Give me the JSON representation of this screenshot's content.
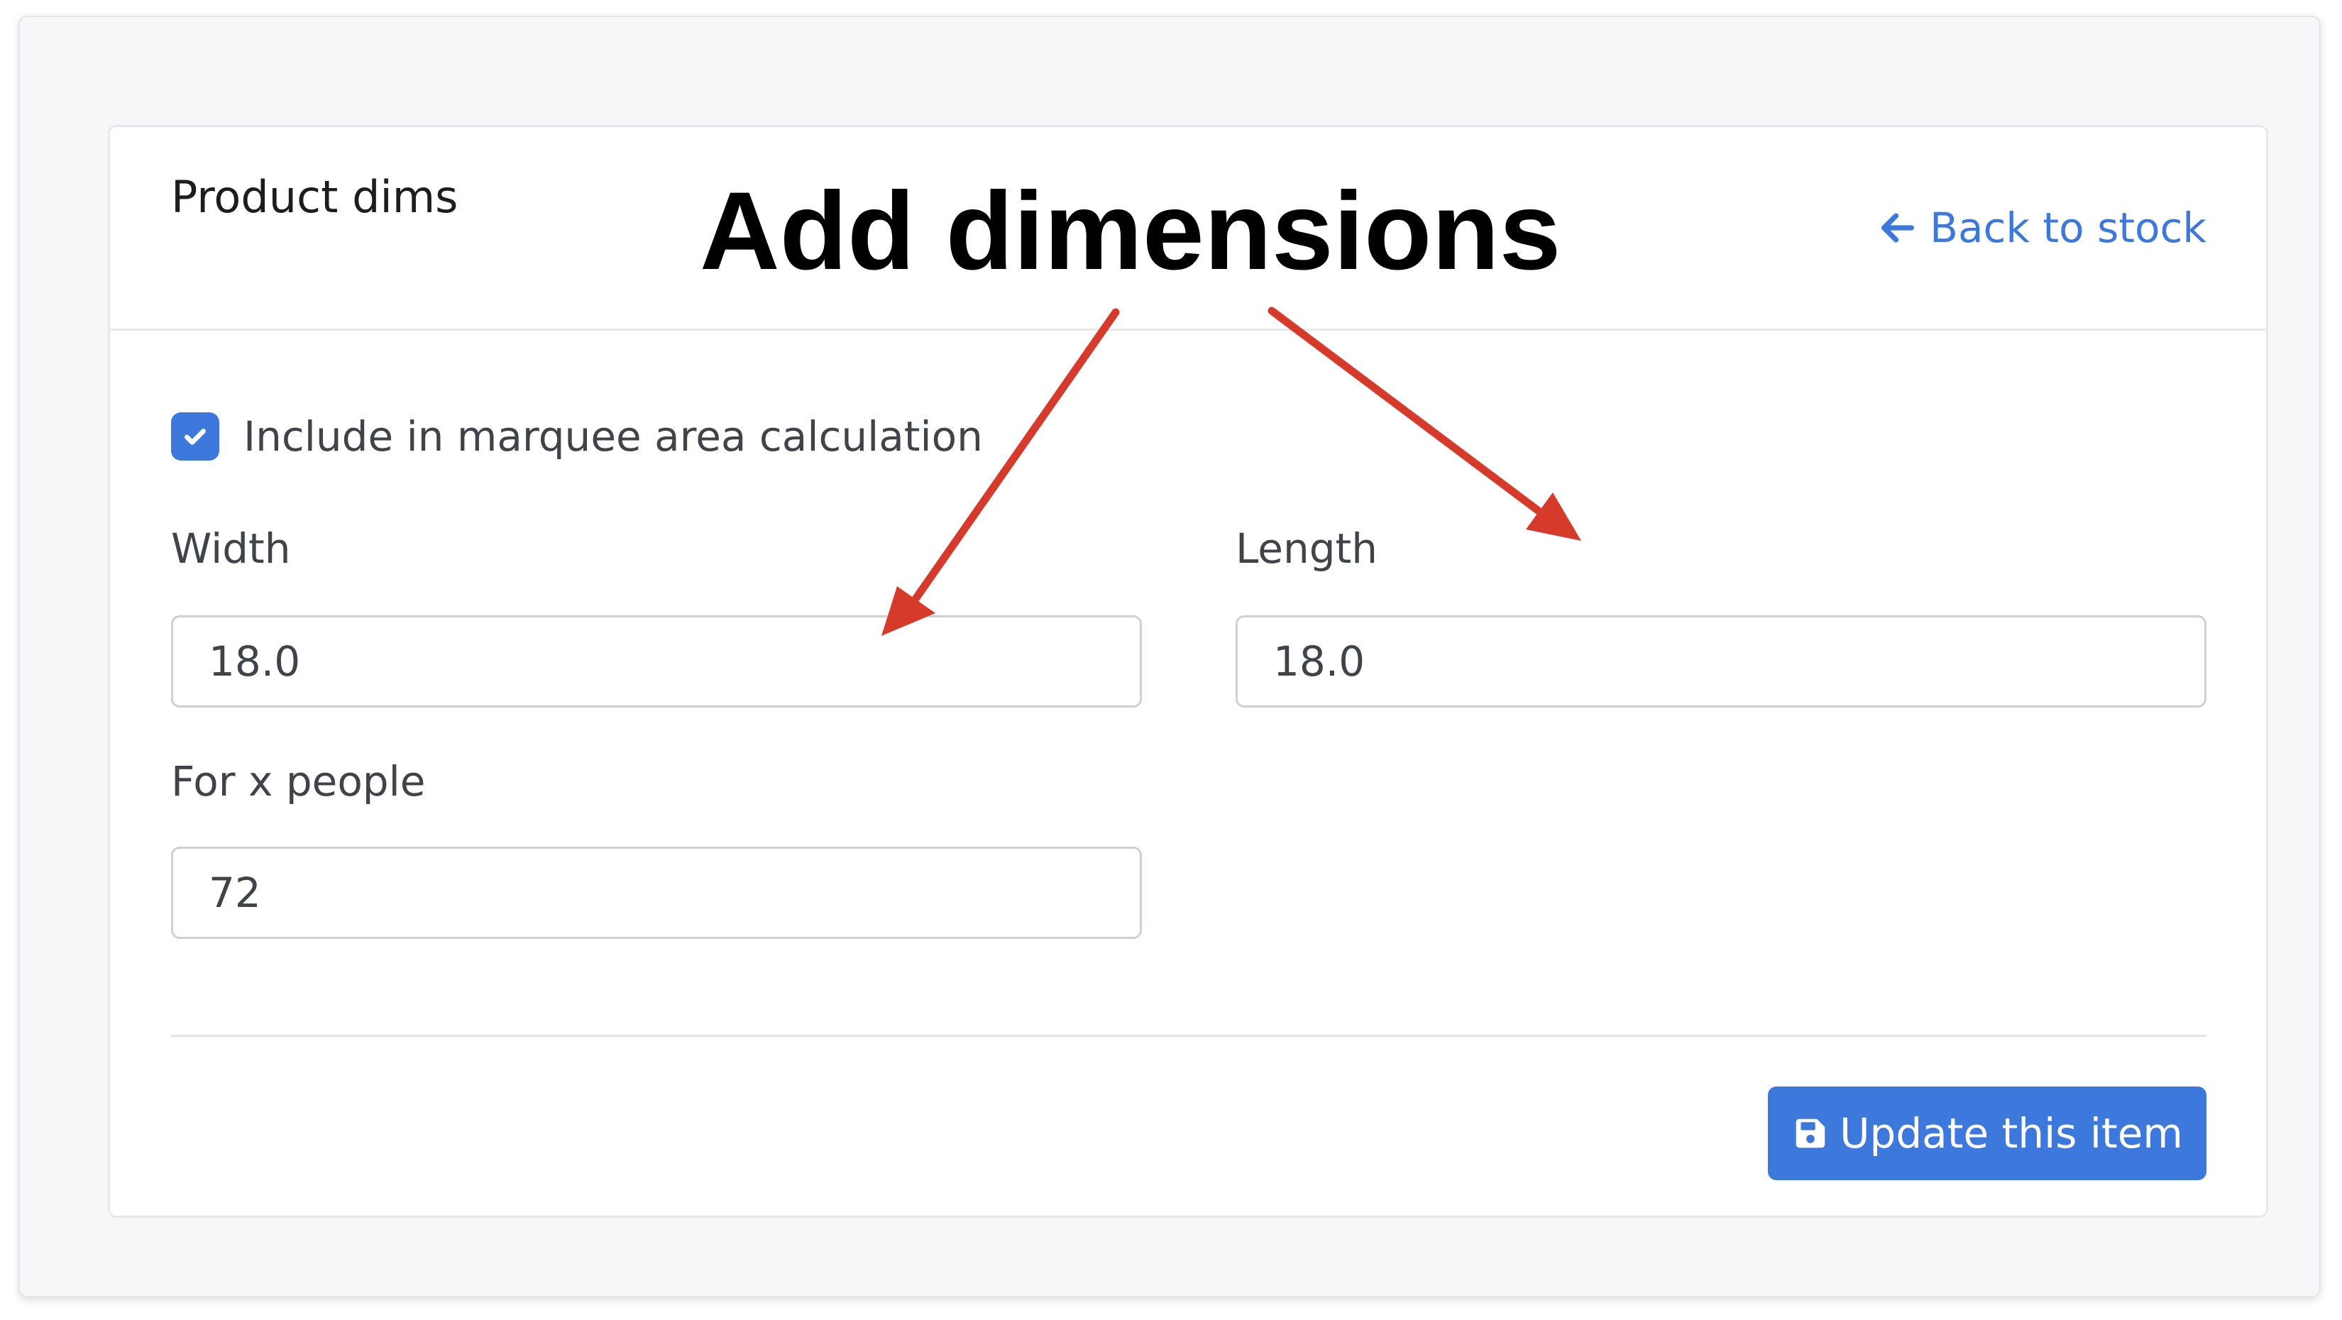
{
  "card": {
    "title": "Product dims",
    "back_link_label": "Back to stock"
  },
  "checkbox": {
    "label": "Include in marquee area calculation",
    "checked": true
  },
  "fields": {
    "width": {
      "label": "Width",
      "value": "18.0"
    },
    "length": {
      "label": "Length",
      "value": "18.0"
    },
    "people": {
      "label": "For x people",
      "value": "72"
    }
  },
  "actions": {
    "update_label": "Update this item"
  },
  "annotation": {
    "title": "Add dimensions",
    "arrow_color": "#d63a2a"
  },
  "colors": {
    "accent": "#3d78dd",
    "background": "#f6f7f9"
  },
  "icons": {
    "back": "arrow-left-icon",
    "check": "check-icon",
    "save": "floppy-disk-icon"
  }
}
